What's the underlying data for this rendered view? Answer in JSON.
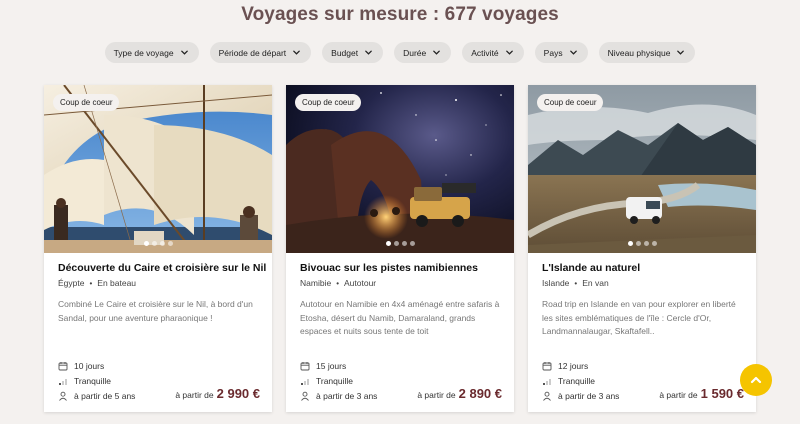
{
  "header": {
    "title": "Voyages sur mesure : 677 voyages"
  },
  "filters": [
    {
      "label": "Type de voyage"
    },
    {
      "label": "Période de départ"
    },
    {
      "label": "Budget"
    },
    {
      "label": "Durée"
    },
    {
      "label": "Activité"
    },
    {
      "label": "Pays"
    },
    {
      "label": "Niveau physique"
    }
  ],
  "cards": [
    {
      "badge": "Coup de coeur",
      "title": "Découverte du Caire et croisière sur le Nil",
      "country": "Égypte",
      "mode": "En bateau",
      "description": "Combiné Le Caire et croisière sur le Nil, à bord d'un Sandal, pour une aventure pharaonique !",
      "duration": "10 jours",
      "level": "Tranquille",
      "age": "à partir de 5 ans",
      "price_prefix": "à partir de",
      "price": "2 990 €",
      "image_icon": "felucca-sails-image"
    },
    {
      "badge": "Coup de coeur",
      "title": "Bivouac sur les pistes namibiennes",
      "country": "Namibie",
      "mode": "Autotour",
      "description": "Autotour en Namibie en 4x4 aménagé entre safaris à Etosha, désert du Namib, Damaraland, grands espaces et nuits sous tente de toit",
      "duration": "15 jours",
      "level": "Tranquille",
      "age": "à partir de 3 ans",
      "price_prefix": "à partir de",
      "price": "2 890 €",
      "image_icon": "night-bivouac-image"
    },
    {
      "badge": "Coup de coeur",
      "title": "L'Islande au naturel",
      "country": "Islande",
      "mode": "En van",
      "description": "Road trip en Islande en van pour explorer en liberté les sites emblématiques de l'île : Cercle d'Or, Landmannalaugar, Skaftafell..",
      "duration": "12 jours",
      "level": "Tranquille",
      "age": "à partir de 3 ans",
      "price_prefix": "à partir de",
      "price": "1 590 €",
      "image_icon": "iceland-van-image"
    }
  ],
  "colors": {
    "accent": "#6a5152",
    "price": "#6a2a2e",
    "scroll_button": "#f5c400",
    "background": "#f4f1ef"
  },
  "icons": {
    "duration": "calendar-icon",
    "level": "signal-bars-icon",
    "age": "person-icon",
    "scroll": "chevron-up-icon"
  }
}
